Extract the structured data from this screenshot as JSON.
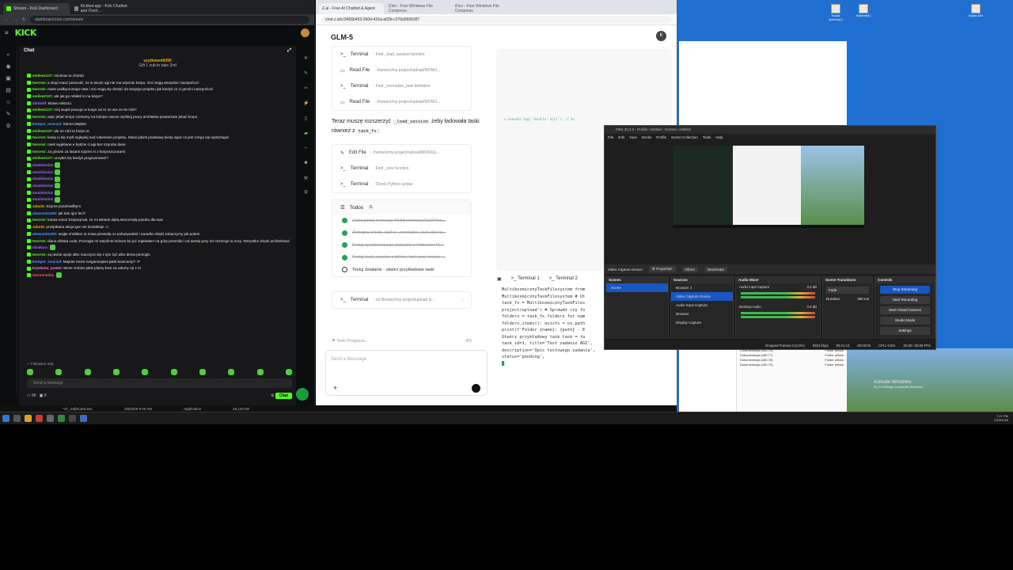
{
  "kick_browser": {
    "tabs": [
      {
        "label": "Stream - Kick Dashboard",
        "active": true
      },
      {
        "label": "Kickbot.app - Kick Chatbot and Overl...",
        "active": false
      }
    ],
    "url": "dashboard.kick.com/stream",
    "chat_title": "Chat",
    "gift_user": "uzytkownik090",
    "gift_text": "Gift 1 sub to take 2nd",
    "messages": [
      {
        "user": "emilee2137:",
        "text": " minimax to chinski",
        "color": "#53fc18"
      },
      {
        "user": "tworrez:",
        "text": " a skąd masz pewność, że w twoim agi nie ma szpontu korpo. Oni mogą wszędzie naszpończć",
        "color": "#53fc18"
      },
      {
        "user": "tworrez:",
        "text": " masz podłączonego nata i oni mogą się dostać do twojego projektu jak kiedyś co ci gemini naszpończć",
        "color": "#53fc18"
      },
      {
        "user": "emilee2137:",
        "text": " ale jak go robiłeś to na korpo?",
        "color": "#53fc18"
      },
      {
        "user": "zbitwolf:",
        "text": " Brawo Mistrzu",
        "color": "#a070ff"
      },
      {
        "user": "emilee2137:",
        "text": " mój wujek pracuje w korpo od AI on wie że Ile robi?",
        "color": "#53fc18"
      },
      {
        "user": "tworrez:",
        "text": " więc jebać korpo czekamy na kolejne owoce ciężkiej pracy architekta powtarzam jebać kropo",
        "color": "#53fc18"
      },
      {
        "user": "kompot_scuczul:",
        "text": " Siema Majster",
        "color": "#4aa3ff"
      },
      {
        "user": "emilee2137:",
        "text": " ale on robi to korpo ai",
        "color": "#53fc18"
      },
      {
        "user": "tworrez:",
        "text": " kiedy ci się myśl najlepiej nad robieniem projektu. Masz jakieś podstawy kiedy apać co jest czego się wystrzegać",
        "color": "#53fc18"
      },
      {
        "user": "tworrez:",
        "text": " mieś wyjebane e będzie ci agi bez szpontu dane",
        "color": "#53fc18"
      },
      {
        "user": "tworrez:",
        "text": " za górami za lasami szpont Ai z korposzczurami",
        "color": "#53fc18"
      },
      {
        "user": "emilee2137:",
        "text": " uczyłeś się kiedyś programować?",
        "color": "#53fc18"
      },
      {
        "user": "staxlolxsinz",
        "text": "",
        "color": "#a070ff",
        "emote": true
      },
      {
        "user": "staxlolxsinz",
        "text": "",
        "color": "#a070ff",
        "emote": true
      },
      {
        "user": "staxlolxsinz",
        "text": "",
        "color": "#a070ff",
        "emote": true
      },
      {
        "user": "staxlolxsinz",
        "text": "",
        "color": "#a070ff",
        "emote": true
      },
      {
        "user": "staxlolxsinz",
        "text": "",
        "color": "#a070ff",
        "emote": true
      },
      {
        "user": "staxlolxsinz",
        "text": "",
        "color": "#a070ff",
        "emote": true
      },
      {
        "user": "Jabol4:",
        "text": " Szpont pozdrowiłbym",
        "color": "#e8b500"
      },
      {
        "user": "alsworck1200:",
        "text": " jak tam igor leci?",
        "color": "#4aa3ff"
      },
      {
        "user": "tworrez:",
        "text": " kurwa rezon trzepnął tak, że mi włosek dębą sterczmęły pozdro dla was",
        "color": "#53fc18"
      },
      {
        "user": "Jabol4:",
        "text": " przejebana akcja igor nie kontaktuje :o",
        "color": "#e8b500"
      },
      {
        "user": "alsworck1200:",
        "text": " wogle zrobiłem ta nowa piramidę co pokazywałeś i naraziłe dzięki zobaczymy jak potem",
        "color": "#4aa3ff"
      },
      {
        "user": "tworrez:",
        "text": " diana zbitata cuda. Pomogła mi wspólnie łodowo bo już zajebałem na górę piramida i od tamtej pory nie rezonuje w nocy. Wszystko dzięki architektowi",
        "color": "#53fc18"
      },
      {
        "user": "dziakura:",
        "text": "",
        "color": "#a070ff",
        "emote": true
      },
      {
        "user": "tworrez:",
        "text": " są dwóie opcje albo nauczysz się z tym żyć albo diena pomoglo",
        "color": "#53fc18"
      },
      {
        "user": "kompot_scuczul:",
        "text": " Majster może zorganizujesz jakiś bootcamp? :P",
        "color": "#4aa3ff"
      },
      {
        "user": "krystiano_pumei:",
        "text": " Moze zrobisz jakis platny kurs na udemy np z AI",
        "color": "#ff7bd5"
      },
      {
        "user": "stormmedia:",
        "text": "",
        "color": "#ff5a5a",
        "emote": true
      }
    ],
    "followers_only": "Followers only",
    "input_placeholder": "Send a message",
    "footer_left_a": "00",
    "footer_left_b": "0",
    "chat_button": "Chat"
  },
  "glm_browser": {
    "tabs": [
      {
        "label": "Z.ai - Free AI Chatbot & Agent",
        "active": true
      },
      {
        "label": "iDev - Free Windows File Compress",
        "active": false
      },
      {
        "label": "iDev - Free Windows File Compress",
        "active": false
      }
    ],
    "url": "chat.z.ai/c/3456b453-2b0d-416a-a02b-c276d3606387",
    "title": "GLM-5",
    "avatar": "K",
    "tool_calls_top": [
      {
        "kind": "Terminal",
        "arg": "Find _load_session function",
        "icon": ">_"
      },
      {
        "kind": "Read File",
        "arg": "/home/z/my-project/upload/MONO...",
        "icon": "▭"
      },
      {
        "kind": "Terminal",
        "arg": "Find _normalize_task definition",
        "icon": ">_"
      },
      {
        "kind": "Read File",
        "arg": "/home/z/my-project/upload/MONO...",
        "icon": "▭"
      }
    ],
    "para_a": "Teraz muszę rozszerzyć ",
    "para_code1": "_load_session",
    "para_b": " żeby ładowała taski również z ",
    "para_code2": "task_fs",
    "para_c": ":",
    "tool_calls_mid": [
      {
        "kind": "Edit File",
        "arg": "/home/z/my-project/upload/MONOU...",
        "icon": "✎"
      },
      {
        "kind": "Terminal",
        "arg": "Find _now function",
        "icon": ">_"
      },
      {
        "kind": "Terminal",
        "arg": "Check Python syntax",
        "icon": ">_"
      }
    ],
    "todos_title": "Todos",
    "todos_count": "5",
    "todos": [
      {
        "text": "Zainicjalizuj instancję MultikosmicznyTaskFiles...",
        "done": true
      },
      {
        "text": "Zintegruj create_task z _normalize_task aby ta...",
        "done": true
      },
      {
        "text": "Dodaj synchronizację statusów z folderami FL...",
        "done": true
      },
      {
        "text": "Dodaj load_session z plików, task przy starcie ...",
        "done": true
      },
      {
        "text": "Testuj działanie - utwórz przykładowe taski",
        "done": false
      }
    ],
    "tool_call_bottom": {
      "kind": "Terminal",
      "arg": "cd /home/z/my-project/upload &..."
    },
    "progress_label": "Todo Progress...",
    "progress_value": "4/5",
    "input_placeholder": "Send a Message",
    "code_preview": "> console.log(`results: ${s}`); // 4s",
    "term_tabs": [
      "Terminal 1",
      "Terminal 2"
    ],
    "terminal_lines": [
      "MultikosmicznyTaskFilesystem from",
      "MultikosmicznyTaskFilesystem # Ut",
      "task_fs = MultikosmicznyTaskFiles",
      "project/upload') # Sprawdź czy fo",
      "folders = task_fs.folders for nam",
      "folders.items(): exists = os.path",
      "print(f'Folder {name}: {path} - E",
      "Utwórz przykładowy task task = ta",
      "task_id=1, title='Test zadanie AGI',",
      "description='Opis testowego zadania',",
      "status='pending',"
    ]
  },
  "obs": {
    "title": "OBS 30.2.3 - Profile: Untitled - Scenes: Untitled",
    "menu": [
      "File",
      "Edit",
      "View",
      "Docks",
      "Profile",
      "Scene Collection",
      "Tools",
      "Help"
    ],
    "source_bar": {
      "source": "Video Capture Device",
      "properties": "Properties",
      "filters": "Filters",
      "deactivate": "Deactivate"
    },
    "scenes_title": "Scenes",
    "scenes": [
      "Scene"
    ],
    "sources_title": "Sources",
    "sources": [
      "Browser 2",
      "Video Capture Device",
      "Audio Input Capture",
      "Browser",
      "Display Capture"
    ],
    "mixer_title": "Audio Mixer",
    "mixer": [
      {
        "name": "Audio Input Capture",
        "db": "0.0 dB"
      },
      {
        "name": "Desktop Audio",
        "db": "0.0 dB"
      }
    ],
    "transitions_title": "Scene Transitions",
    "transition": "Fade",
    "duration_label": "Duration",
    "duration": "300 ms",
    "controls_title": "Controls",
    "controls": [
      "Stop Streaming",
      "Start Recording",
      "Start Virtual Camera",
      "Studio Mode",
      "Settings"
    ],
    "status": [
      "Dropped Frames 0 (0.0%)",
      "8262 kbps",
      "00:21:13",
      "00:00:00",
      "CPU: 0.8%",
      "30.00 / 30.00 FPS"
    ]
  },
  "desktop": {
    "icons": [
      {
        "label": "Kopia kickbot(1)"
      },
      {
        "label": "Kickbot(1)"
      },
      {
        "label": "Kopia AGI"
      }
    ],
    "fe_rows": [
      {
        "name": "Dokumentacja (v80-76)",
        "type": "Folder plików"
      },
      {
        "name": "Dokumentacja (v80-77)",
        "type": "Folder plików"
      },
      {
        "name": "Dokumentacja (v80-78)",
        "type": "Folder plików"
      },
      {
        "name": "Dokumentacja (v80-79)",
        "type": "Folder plików"
      }
    ],
    "activate": "Activate Windows",
    "activate_sub": "Go to Settings to activate Windows."
  },
  "taskbar": {
    "file": "VC_redist.x64.exe",
    "date_mod": "1/6/2026 9:46 AM",
    "type": "Application",
    "size": "25,124 KB",
    "time": "7:27 PM",
    "date": "2/24/2026"
  }
}
